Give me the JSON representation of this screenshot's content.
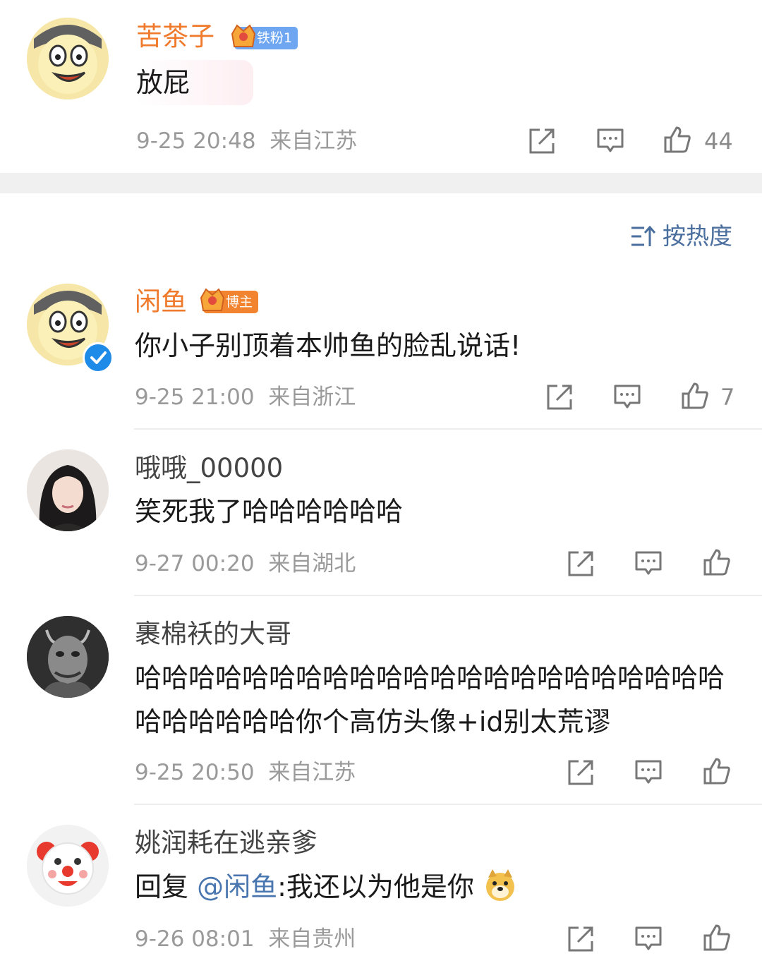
{
  "sort": {
    "label": "按热度"
  },
  "comments": [
    {
      "name": "苦茶子",
      "badge": {
        "label": "铁粉1",
        "color": "#6ea6f2",
        "level": "5"
      },
      "text": "放屁",
      "time": "9-25 20:48",
      "location": "来自江苏",
      "likes": "44"
    },
    {
      "name": "闲鱼",
      "badge": {
        "label": "博主",
        "color": "#f3842f",
        "level": "7"
      },
      "text": "你小子别顶着本帅鱼的脸乱说话!",
      "time": "9-25 21:00",
      "location": "来自浙江",
      "likes": "7",
      "verified": true
    },
    {
      "name": "哦哦_00000",
      "text": "笑死我了哈哈哈哈哈哈",
      "time": "9-27 00:20",
      "location": "来自湖北"
    },
    {
      "name": "裹棉袄的大哥",
      "text": "哈哈哈哈哈哈哈哈哈哈哈哈哈哈哈哈哈哈哈哈哈哈哈哈哈哈哈哈你个高仿头像+id别太荒谬",
      "time": "9-25 20:50",
      "location": "来自江苏"
    },
    {
      "name": "姚润耗在逃亲爹",
      "reply_prefix": "回复",
      "mention": "@闲鱼",
      "text": ":我还以为他是你",
      "emoji": "doge-emoji",
      "time": "9-26 08:01",
      "location": "来自贵州"
    }
  ],
  "icons": {
    "share": "share-icon",
    "comment": "comment-icon",
    "like": "thumbs-up-icon"
  },
  "colors": {
    "username_highlight": "#f07a2c",
    "link": "#4a76b0",
    "meta": "#9a9a9a",
    "separator": "#f0f0f0"
  }
}
